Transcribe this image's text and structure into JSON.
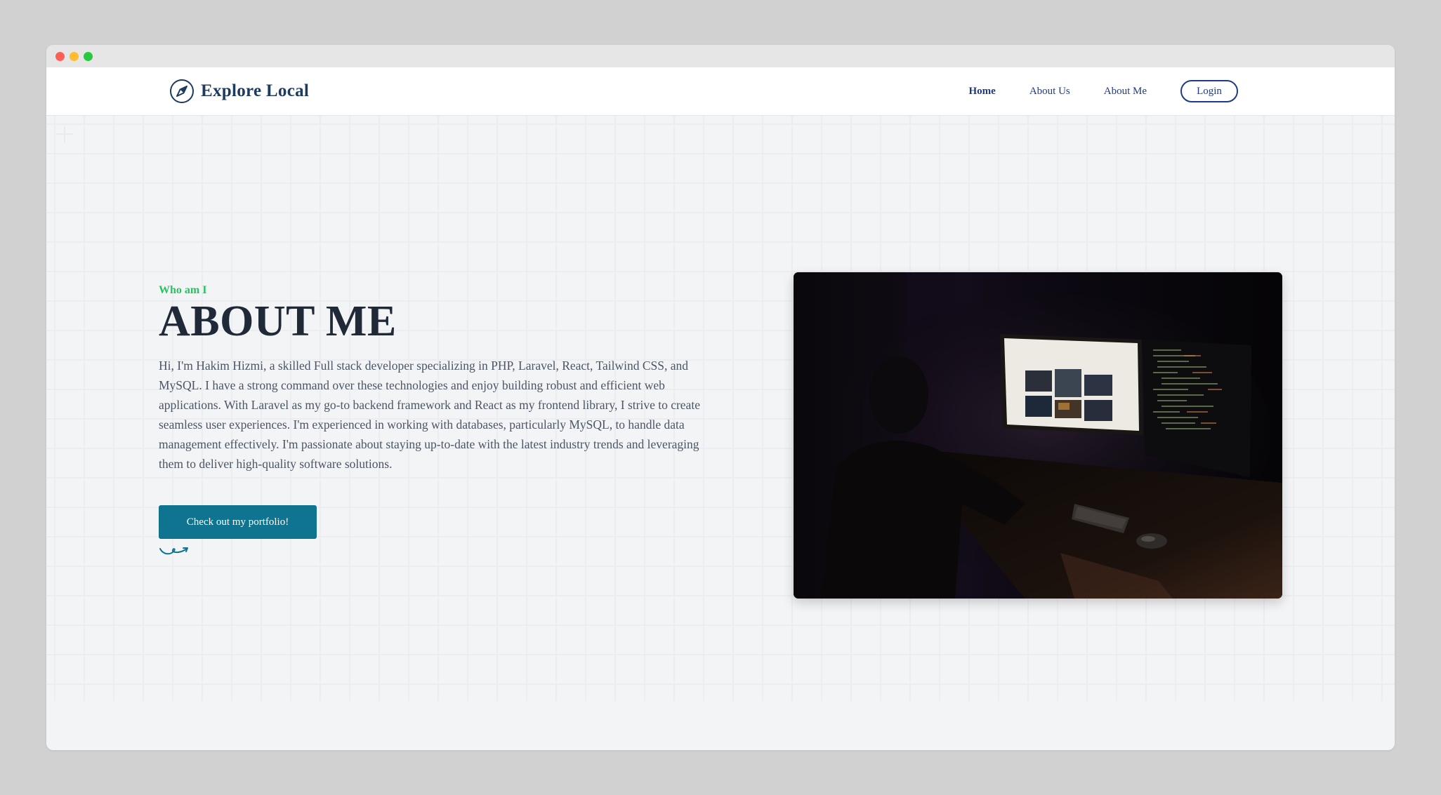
{
  "brand": {
    "name": "Explore Local",
    "icon": "compass-icon"
  },
  "nav": {
    "links": [
      {
        "label": "Home",
        "active": true
      },
      {
        "label": "About Us",
        "active": false
      },
      {
        "label": "About Me",
        "active": false
      }
    ],
    "login_label": "Login"
  },
  "hero": {
    "eyebrow": "Who am I",
    "title": "ABOUT ME",
    "paragraph": "Hi, I'm Hakim Hizmi, a skilled Full stack developer specializing in PHP, Laravel, React, Tailwind CSS, and MySQL. I have a strong command over these technologies and enjoy building robust and efficient web applications. With Laravel as my go-to backend framework and React as my frontend library, I strive to create seamless user experiences. I'm experienced in working with databases, particularly MySQL, to handle data management effectively. I'm passionate about staying up-to-date with the latest industry trends and leveraging them to deliver high-quality software solutions.",
    "cta_label": "Check out my portfolio!",
    "decoration_icon": "squiggle-arrow-icon"
  },
  "photo": {
    "icon": "developer-at-desk-photo"
  },
  "colors": {
    "brand": "#1d3a5f",
    "nav": "#1e3a8a",
    "accent_green": "#22c55e",
    "button": "#0e7490",
    "heading": "#1f2937",
    "body_text": "#4b5563"
  }
}
